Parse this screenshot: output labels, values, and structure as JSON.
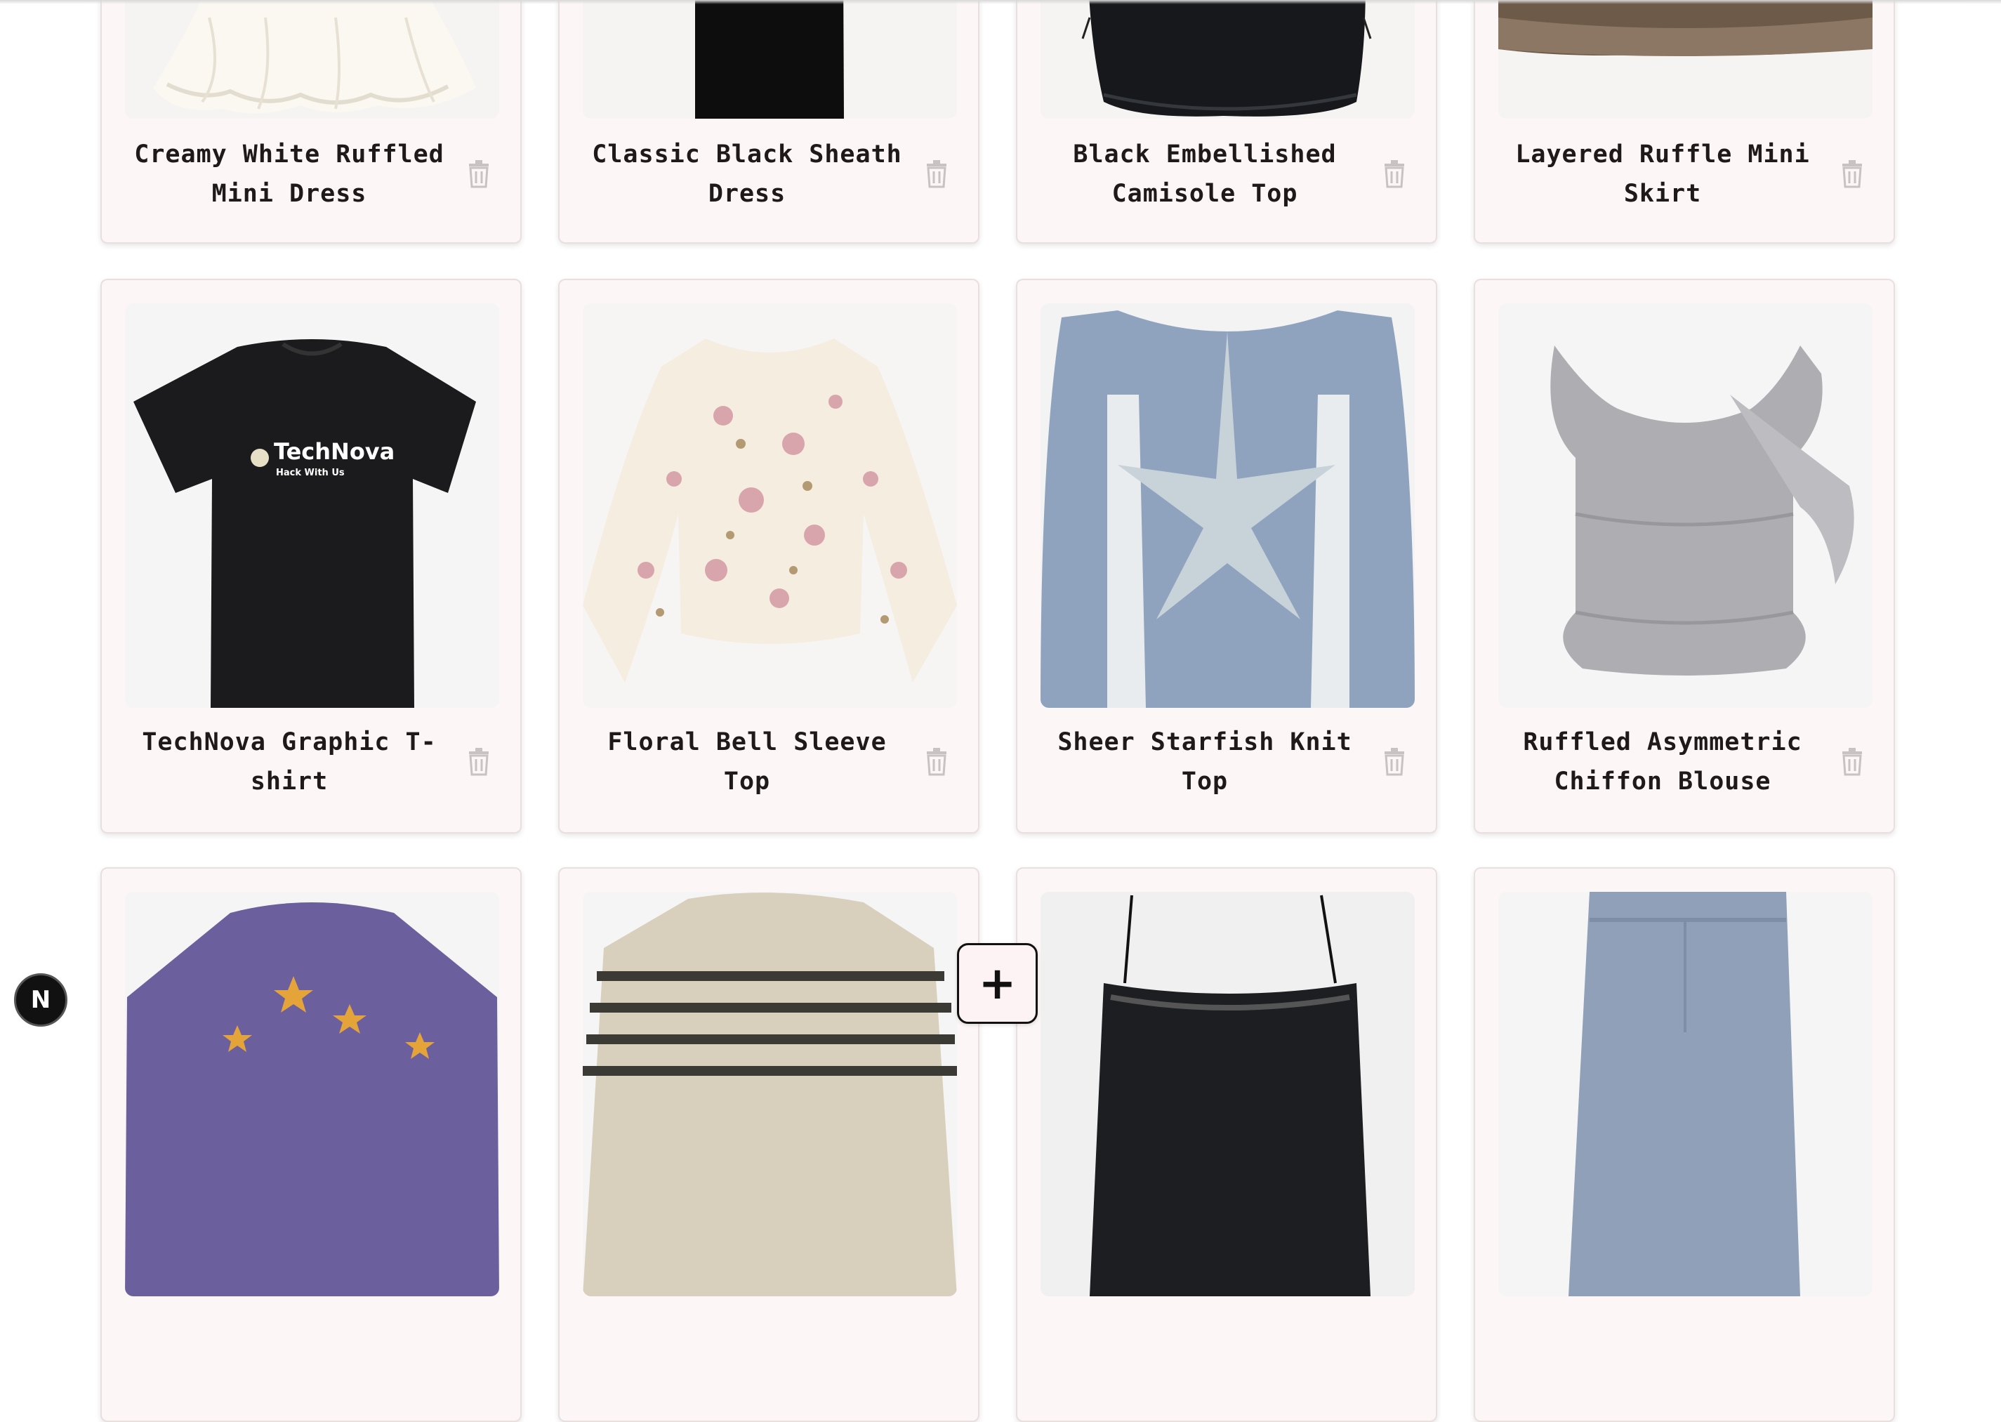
{
  "colors": {
    "card_bg": "#fdf6f6",
    "trash": "#c9c2c2",
    "fab_bg": "#fdf3f5"
  },
  "rows": [
    {
      "items": [
        {
          "title": "Creamy White Ruffled Mini Dress",
          "image": "white-ruffle-dress"
        },
        {
          "title": "Classic Black Sheath Dress",
          "image": "black-sheath-dress"
        },
        {
          "title": "Black Embellished Camisole Top",
          "image": "black-camisole"
        },
        {
          "title": "Layered Ruffle Mini Skirt",
          "image": "brown-ruffle-skirt"
        }
      ]
    },
    {
      "items": [
        {
          "title": "TechNova Graphic T-shirt",
          "image": "black-tshirt",
          "print_text": "TechNova",
          "print_sub": "Hack With Us"
        },
        {
          "title": "Floral Bell Sleeve Top",
          "image": "floral-top"
        },
        {
          "title": "Sheer Starfish Knit Top",
          "image": "blue-knit-top"
        },
        {
          "title": "Ruffled Asymmetric Chiffon Blouse",
          "image": "grey-chiffon-blouse"
        }
      ]
    },
    {
      "items": [
        {
          "image": "purple-star-sweater"
        },
        {
          "image": "striped-sweater"
        },
        {
          "image": "black-lace-cami"
        },
        {
          "image": "blue-jeans"
        }
      ]
    }
  ],
  "fab": {
    "label": "+"
  },
  "badge": {
    "label": "N"
  }
}
